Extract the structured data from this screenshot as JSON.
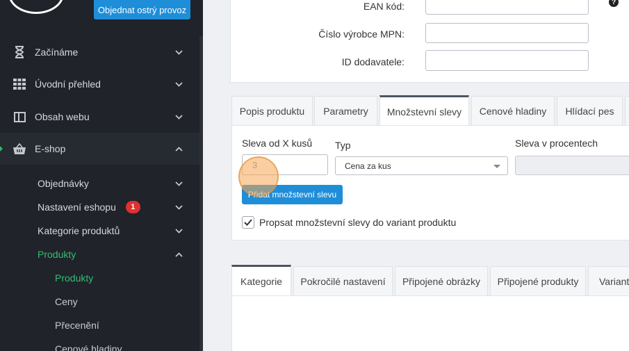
{
  "header": {
    "order_button": "Objednat ostrý provoz"
  },
  "sidebar": {
    "items": [
      {
        "label": "Začínáme",
        "icon": "hourglass-icon"
      },
      {
        "label": "Úvodní přehled",
        "icon": "grid-icon"
      },
      {
        "label": "Obsah webu",
        "icon": "layout-icon"
      },
      {
        "label": "E-shop",
        "icon": "basket-icon"
      }
    ],
    "eshop_sub": [
      {
        "label": "Objednávky"
      },
      {
        "label": "Nastavení eshopu",
        "badge": "1"
      },
      {
        "label": "Kategorie produktů"
      },
      {
        "label": "Produkty"
      }
    ],
    "produkty_sub": [
      {
        "label": "Produkty"
      },
      {
        "label": "Ceny"
      },
      {
        "label": "Přecenění"
      },
      {
        "label": "Cenové hladiny"
      }
    ]
  },
  "product_form": {
    "ean_label": "EAN kód:",
    "mpn_label": "Číslo výrobce MPN:",
    "supplier_id_label": "ID dodavatele:"
  },
  "tabs_top": [
    "Popis produktu",
    "Parametry",
    "Množstevní slevy",
    "Cenové hladiny",
    "Hlídací pes"
  ],
  "tabs_top_active": "Množstevní slevy",
  "discount": {
    "qty_label": "Sleva od X kusů",
    "qty_value": "3",
    "type_label": "Typ",
    "type_value": "Cena za kus",
    "percent_label": "Sleva v procentech",
    "add_button": "Přidat množstevní slevu",
    "propagate_label": "Propsat množstevní slevy do variant produktu",
    "propagate_checked": true
  },
  "tabs_bottom": [
    "Kategorie",
    "Pokročilé nastavení",
    "Připojené obrázky",
    "Připojené produkty",
    "Varianty"
  ],
  "tabs_bottom_active": "Kategorie",
  "colors": {
    "accent": "#1e8ed8",
    "sidebar_bg": "#20232a",
    "active_green": "#2fc073",
    "badge_red": "#e0312f"
  }
}
